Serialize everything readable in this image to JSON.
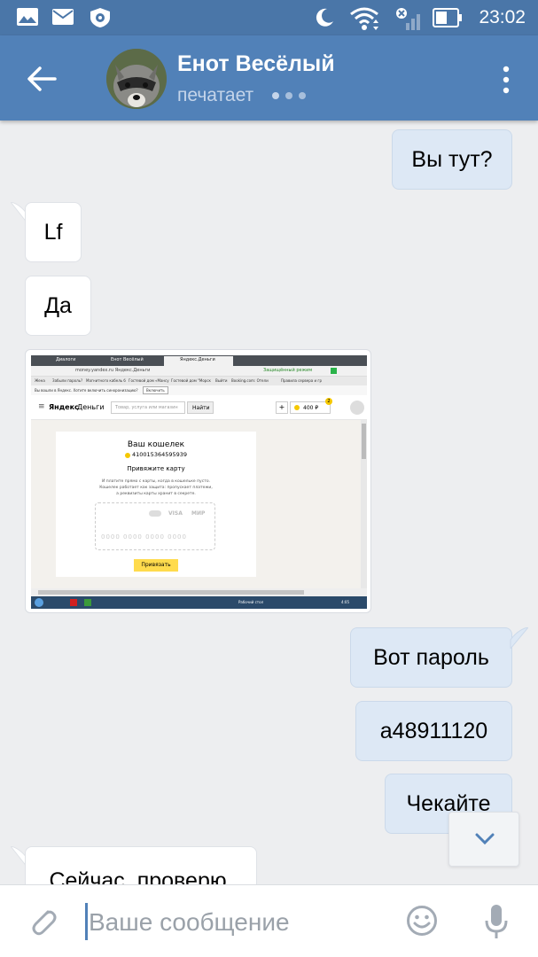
{
  "status_bar": {
    "time": "23:02",
    "icons": [
      "gallery-icon",
      "mail-icon",
      "vpn-shield-icon",
      "moon-icon",
      "wifi-icon",
      "no-signal-icon",
      "battery-icon"
    ]
  },
  "header": {
    "contact_name": "Енот Весёлый",
    "status": "печатает",
    "colors": {
      "bar": "#5181b8",
      "status_bar": "#4a76a8"
    }
  },
  "messages": [
    {
      "direction": "out",
      "text": "Вы тут?"
    },
    {
      "direction": "in",
      "text": "Lf"
    },
    {
      "direction": "in",
      "text": "Да"
    },
    {
      "direction": "in",
      "type": "photo"
    },
    {
      "direction": "out",
      "text": "Вот пароль"
    },
    {
      "direction": "out",
      "text": "a48911120"
    },
    {
      "direction": "out",
      "text": "Чекайте"
    },
    {
      "direction": "in",
      "text": "Сейчас, проверю."
    }
  ],
  "photo": {
    "tabs": [
      "Диалоги",
      "Енот Весёлый",
      "Яндекс.Деньги"
    ],
    "url": "money.yandex.ru  Яндекс.Деньги",
    "protected": "Защищённый режим",
    "bookmarks": [
      "Жена",
      "Забыли пароль?",
      "Магнитного кабель б",
      "Гостевой дом «Мансу",
      "Гостевой дом \"Морск",
      "Выйти",
      "Booking.com: Отели",
      "Правила сервера и гр"
    ],
    "notice": "Вы вошли в Яндекс. Хотите включить синхронизацию?",
    "notice_button": "Включить",
    "logo_brand": "Яндекс",
    "logo_product": "Деньги",
    "search_placeholder": "Товар, услуга или магазин",
    "find_button": "Найти",
    "plus": "+",
    "balance": "400 ₽",
    "badge": "2",
    "wallet_title": "Ваш кошелек",
    "wallet_number": "410015364595939",
    "link_card": "Привяжите карту",
    "info_line1": "И платите прямо с карты, когда в кошельке пусто.",
    "info_line2": "Кошелек работает как защита: пропускает платежи,",
    "info_line3": "а реквизиты карты хранит в секрете.",
    "card_visa": "VISA",
    "card_mir": "МИР",
    "card_number_placeholder": "0000 0000 0000 0000",
    "bind_button": "Привязать",
    "taskbar_text": "Рабочий стол",
    "taskbar_time": "4:05"
  },
  "input": {
    "placeholder": "Ваше сообщение"
  }
}
